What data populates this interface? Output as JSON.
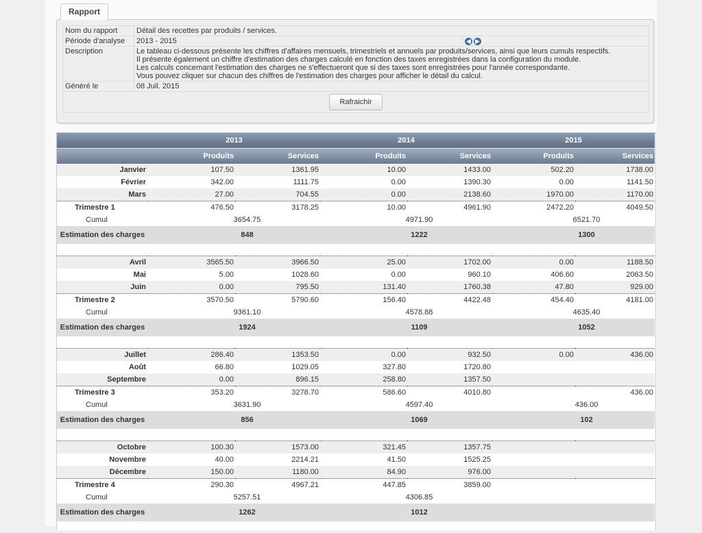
{
  "tab": {
    "label": "Rapport"
  },
  "info": {
    "rows": [
      {
        "key": "Nom du rapport",
        "value": "Détail des recettes par produits / services."
      },
      {
        "key": "Période d'analyse",
        "value": "2013 - 2015"
      },
      {
        "key": "Description",
        "lines": [
          "Le tableau ci-dessous présente les chiffres d'affaires mensuels, trimestriels et annuels par produits/services, ainsi que leurs cumuls respectifs.",
          "Il présente également un chiffre d'estimation des charges calculé en fonction des taxes enregistrées dans la configuration du module.",
          "Les calculs concernant l'estimation des charges ne s'effectueront que si des taxes sont enregistrées pour l'année correspondante.",
          "Vous pouvez cliquer sur chacun des chiffres de l'estimation des charges pour afficher le détail du calcul."
        ]
      },
      {
        "key": "Généré le",
        "value": "08 Juil. 2015"
      }
    ],
    "prev_icon": "arrow-left-circle-icon",
    "next_icon": "arrow-right-circle-icon",
    "refresh_label": "Rafraichir"
  },
  "report": {
    "years": [
      "2013",
      "2014",
      "2015"
    ],
    "sub_headers": [
      "Produits",
      "Services"
    ],
    "quarters": [
      {
        "months": [
          {
            "name": "Janvier",
            "values": [
              "107.50",
              "1361.95",
              "10.00",
              "1433.00",
              "502.20",
              "1738.00"
            ]
          },
          {
            "name": "Février",
            "values": [
              "342.00",
              "1111.75",
              "0.00",
              "1390.30",
              "0.00",
              "1141.50"
            ]
          },
          {
            "name": "Mars",
            "values": [
              "27.00",
              "704.55",
              "0.00",
              "2138.60",
              "1970.00",
              "1170.00"
            ]
          }
        ],
        "trimestre": {
          "label": "Trimestre 1",
          "values": [
            "476.50",
            "3178.25",
            "10.00",
            "4961.90",
            "2472.20",
            "4049.50"
          ]
        },
        "cumul": {
          "label": "Cumul",
          "values": [
            "3654.75",
            "4971.90",
            "6521.70"
          ]
        },
        "estimation": {
          "label": "Estimation des charges",
          "values": [
            "848",
            "1222",
            "1300"
          ]
        }
      },
      {
        "months": [
          {
            "name": "Avril",
            "values": [
              "3565.50",
              "3966.50",
              "25.00",
              "1702.00",
              "0.00",
              "1188.50"
            ]
          },
          {
            "name": "Mai",
            "values": [
              "5.00",
              "1028.60",
              "0.00",
              "960.10",
              "406.60",
              "2063.50"
            ]
          },
          {
            "name": "Juin",
            "values": [
              "0.00",
              "795.50",
              "131.40",
              "1760.38",
              "47.80",
              "929.00"
            ]
          }
        ],
        "trimestre": {
          "label": "Trimestre 2",
          "values": [
            "3570.50",
            "5790.60",
            "156.40",
            "4422.48",
            "454.40",
            "4181.00"
          ]
        },
        "cumul": {
          "label": "Cumul",
          "values": [
            "9361.10",
            "4578.88",
            "4635.40"
          ]
        },
        "estimation": {
          "label": "Estimation des charges",
          "values": [
            "1924",
            "1109",
            "1052"
          ]
        }
      },
      {
        "months": [
          {
            "name": "Juillet",
            "values": [
              "286.40",
              "1353.50",
              "0.00",
              "932.50",
              "0.00",
              "436.00"
            ]
          },
          {
            "name": "Août",
            "values": [
              "66.80",
              "1029.05",
              "327.80",
              "1720.80",
              "",
              ""
            ]
          },
          {
            "name": "Septembre",
            "values": [
              "0.00",
              "896.15",
              "258.80",
              "1357.50",
              "",
              ""
            ]
          }
        ],
        "trimestre": {
          "label": "Trimestre 3",
          "values": [
            "353.20",
            "3278.70",
            "586.60",
            "4010.80",
            "",
            "436.00"
          ]
        },
        "cumul": {
          "label": "Cumul",
          "values": [
            "3631.90",
            "4597.40",
            "436.00"
          ]
        },
        "estimation": {
          "label": "Estimation des charges",
          "values": [
            "856",
            "1069",
            "102"
          ]
        }
      },
      {
        "months": [
          {
            "name": "Octobre",
            "values": [
              "100.30",
              "1573.00",
              "321.45",
              "1357.75",
              "",
              ""
            ]
          },
          {
            "name": "Novembre",
            "values": [
              "40.00",
              "2214.21",
              "41.50",
              "1525.25",
              "",
              ""
            ]
          },
          {
            "name": "Décembre",
            "values": [
              "150.00",
              "1180.00",
              "84.90",
              "976.00",
              "",
              ""
            ]
          }
        ],
        "trimestre": {
          "label": "Trimestre 4",
          "values": [
            "290.30",
            "4967.21",
            "447.85",
            "3859.00",
            "",
            ""
          ]
        },
        "cumul": {
          "label": "Cumul",
          "values": [
            "5257.51",
            "4306.85",
            ""
          ]
        },
        "estimation": {
          "label": "Estimation des charges",
          "values": [
            "1262",
            "1012",
            ""
          ]
        }
      }
    ]
  }
}
